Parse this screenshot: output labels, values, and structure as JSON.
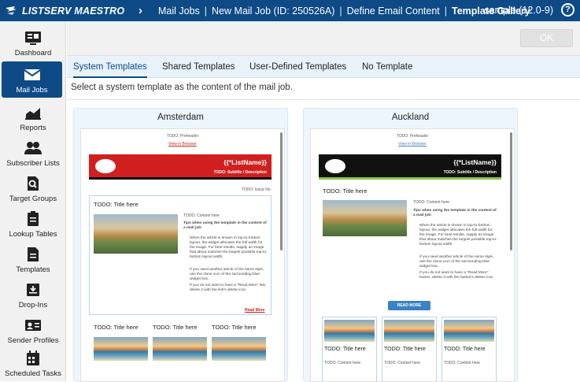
{
  "app": {
    "title": "LISTSERV MAESTRO",
    "user": "sample (12.0-9)",
    "help": "?"
  },
  "breadcrumb": [
    "Mail Jobs",
    "New Mail Job (ID: 250526A)",
    "Define Email Content",
    "Template Gallery"
  ],
  "breadcrumb_sep": "|",
  "sidebar": {
    "items": [
      {
        "label": "Dashboard",
        "icon": "dashboard-icon"
      },
      {
        "label": "Mail Jobs",
        "icon": "envelope-icon",
        "active": true
      },
      {
        "label": "Reports",
        "icon": "chart-icon"
      },
      {
        "label": "Subscriber Lists",
        "icon": "people-icon"
      },
      {
        "label": "Target Groups",
        "icon": "search-doc-icon"
      },
      {
        "label": "Lookup Tables",
        "icon": "clipboard-icon"
      },
      {
        "label": "Templates",
        "icon": "document-icon"
      },
      {
        "label": "Drop-Ins",
        "icon": "drop-in-icon"
      },
      {
        "label": "Sender Profiles",
        "icon": "id-card-icon"
      },
      {
        "label": "Scheduled Tasks",
        "icon": "calendar-icon"
      }
    ]
  },
  "toolbar": {
    "ok_label": "OK"
  },
  "tabs": [
    {
      "label": "System Templates",
      "active": true
    },
    {
      "label": "Shared Templates"
    },
    {
      "label": "User-Defined Templates"
    },
    {
      "label": "No Template"
    }
  ],
  "instruction": "Select a system template as the content of the mail job.",
  "templates": [
    {
      "name": "Amsterdam",
      "preheader": "TODO: Preheader",
      "view_in_browser": "View in Browser",
      "list_name": "{{*ListName}}",
      "subtitle": "TODO: Subtitle / Description",
      "issue": "TODO: Issue No.",
      "title": "TODO: Title here",
      "content": "TODO: Content here",
      "tips_heading": "Tips when using the template in the content of a mail job:",
      "tips": [
        "When the article is shown in top-to-bottom layout, the widget allocates the full width for the image. For best results, supply an image that about matches the largest possible top-to-bottom layout width.",
        "If you need another article of the same style, use the clone icon of the surrounding blue widget box.",
        "If you do not want to have a \"Read More\" link, delete it with the link's delete icon."
      ],
      "read_more": "Read More",
      "sub_titles": [
        "TODO: Title here",
        "TODO: Title here",
        "TODO: Title here"
      ],
      "accent": "#d11f1f"
    },
    {
      "name": "Auckland",
      "preheader": "TODO: Preheader",
      "view_in_browser": "View in Browser",
      "list_name": "{{*ListName}}",
      "subtitle": "TODO: Subtitle / Description",
      "title": "TODO: Title here",
      "content": "TODO: Content here",
      "tips_heading": "Tips when using the template in the content of a mail job:",
      "tips": [
        "When the article is shown in top-to-bottom layout, the widget allocates the full width for the image. For best results, supply an image that about matches the largest possible top-to-bottom layout width.",
        "If you need another article of the same style, use the clone icon of the surrounding blue widget box.",
        "If you do not want to have a \"Read More\" button, delete it with the button's delete icon."
      ],
      "read_more": "READ MORE",
      "sub_titles": [
        "TODO: Title here",
        "TODO: Title here",
        "TODO: Title here"
      ],
      "sub_content": [
        "TODO: Content here",
        "TODO: Content here",
        "TODO: Content here"
      ],
      "accent": "#111111"
    }
  ],
  "colors": {
    "brand": "#0d4a86",
    "tab_bg": "#e8f2fb",
    "card_bg": "#eef6fd"
  }
}
